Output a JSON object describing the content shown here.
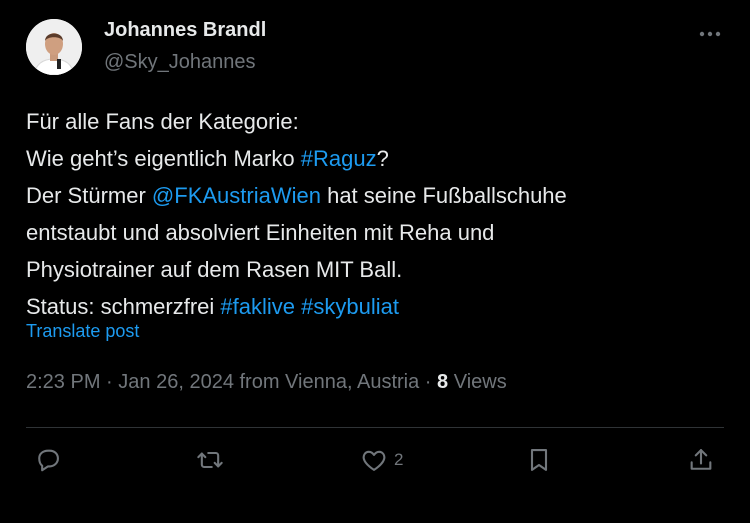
{
  "author": {
    "name": "Johannes Brandl",
    "handle": "@Sky_Johannes"
  },
  "tweet": {
    "lines": [
      [
        {
          "t": "Für alle Fans der Kategorie:"
        }
      ],
      [
        {
          "t": "Wie geht’s eigentlich Marko "
        },
        {
          "t": "#Raguz",
          "link": true
        },
        {
          "t": "?"
        }
      ],
      [
        {
          "t": "Der Stürmer "
        },
        {
          "t": "@FKAustriaWien",
          "link": true
        },
        {
          "t": " hat seine Fußballschuhe"
        }
      ],
      [
        {
          "t": "entstaubt und absolviert Einheiten mit Reha und"
        }
      ],
      [
        {
          "t": "Physiotrainer auf dem Rasen MIT Ball."
        }
      ],
      [
        {
          "t": "Status: schmerzfrei "
        },
        {
          "t": "#faklive",
          "link": true
        },
        {
          "t": " "
        },
        {
          "t": "#skybuliat",
          "link": true
        }
      ]
    ],
    "translate_label": "Translate post"
  },
  "meta": {
    "time": "2:23 PM",
    "separator": "·",
    "date": "Jan 26, 2024",
    "location": "from Vienna, Austria",
    "views_count": "8",
    "views_label": "Views"
  },
  "actions": {
    "reply_icon": "reply-icon",
    "retweet_icon": "retweet-icon",
    "like_icon": "heart-icon",
    "like_count": "2",
    "bookmark_icon": "bookmark-icon",
    "share_icon": "share-icon"
  },
  "colors": {
    "background": "#000000",
    "text": "#e7e9ea",
    "muted": "#71767b",
    "link": "#1d9bf0"
  }
}
